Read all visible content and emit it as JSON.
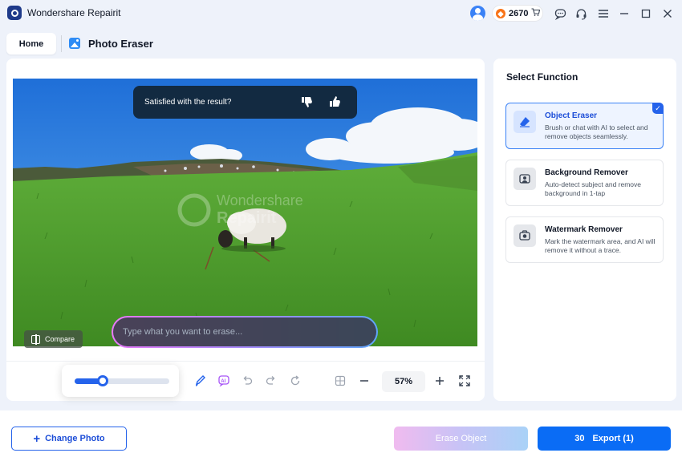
{
  "app": {
    "title": "Wondershare Repairit"
  },
  "titlebar": {
    "credits": "2670",
    "icons": [
      "user-avatar-icon",
      "coin-icon",
      "cart-icon",
      "message-icon",
      "headset-icon",
      "menu-icon",
      "minimize-icon",
      "maximize-icon",
      "close-icon"
    ]
  },
  "nav": {
    "home": "Home",
    "current": "Photo Eraser"
  },
  "canvas": {
    "feedback": "Satisfied with the result?",
    "compare": "Compare",
    "prompt_placeholder": "Type what you want to erase...",
    "watermark_line1": "Wondershare",
    "watermark_line2": "Repairit"
  },
  "toolbar": {
    "brush_size": 0.3,
    "zoom": "57%",
    "icons": [
      "brush-icon",
      "ai-chat-icon",
      "undo-icon",
      "redo-icon",
      "reset-icon",
      "split-view-icon",
      "zoom-out-icon",
      "zoom-in-icon",
      "fullscreen-icon"
    ]
  },
  "sidebar": {
    "title": "Select Function",
    "functions": [
      {
        "title": "Object Eraser",
        "desc": "Brush or chat with AI to select and remove objects seamlessly.",
        "selected": true
      },
      {
        "title": "Background Remover",
        "desc": "Auto-detect subject and remove background in 1-tap",
        "selected": false
      },
      {
        "title": "Watermark Remover",
        "desc": "Mark the watermark area, and AI will remove it without a trace.",
        "selected": false
      }
    ]
  },
  "footer": {
    "change_photo": "Change Photo",
    "erase_object": "Erase Object",
    "export_count": "30",
    "export_label": "Export (1)"
  },
  "colors": {
    "accent": "#2563eb",
    "export": "#0a6cf5"
  }
}
